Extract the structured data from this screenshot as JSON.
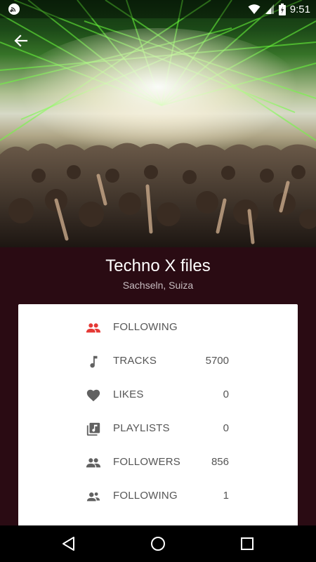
{
  "status_bar": {
    "time": "9:51",
    "icons": [
      "cast-icon",
      "wifi-icon",
      "signal-icon",
      "battery-icon"
    ]
  },
  "header": {
    "image": "concert-crowd-with-green-lasers",
    "back_icon": "arrow-back-icon"
  },
  "profile": {
    "name": "Techno X files",
    "location": "Sachseln, Suiza"
  },
  "stats": [
    {
      "icon": "people-icon",
      "label": "FOLLOWING",
      "value": "",
      "accent": "#e53935"
    },
    {
      "icon": "music-note-icon",
      "label": "TRACKS",
      "value": "5700"
    },
    {
      "icon": "heart-icon",
      "label": "LIKES",
      "value": "0"
    },
    {
      "icon": "playlist-icon",
      "label": "PLAYLISTS",
      "value": "0"
    },
    {
      "icon": "people-icon",
      "label": "FOLLOWERS",
      "value": "856"
    },
    {
      "icon": "person-group-icon",
      "label": "FOLLOWING",
      "value": "1"
    }
  ],
  "nav_bar": {
    "icons": [
      "back-triangle-icon",
      "home-circle-icon",
      "recents-square-icon"
    ]
  },
  "colors": {
    "background": "#2a0b13",
    "card": "#ffffff",
    "accent": "#e53935",
    "icon": "#616161"
  }
}
